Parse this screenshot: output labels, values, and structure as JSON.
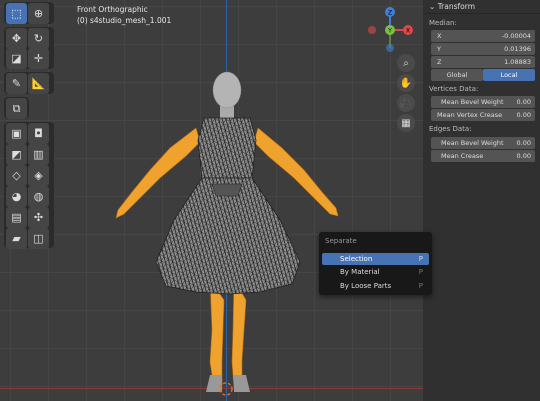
{
  "viewport": {
    "view_name": "Front Orthographic",
    "object_name": "(0) s4studio_mesh_1.001"
  },
  "toolbar": {
    "tools": [
      {
        "icon": "select-box-icon",
        "glyph": "⬚",
        "active": true
      },
      {
        "icon": "cursor-icon",
        "glyph": "⊕",
        "active": false
      },
      {
        "icon": "move-icon",
        "glyph": "✥",
        "active": false
      },
      {
        "icon": "rotate-icon",
        "glyph": "↻",
        "active": false
      },
      {
        "icon": "scale-icon",
        "glyph": "◪",
        "active": false
      },
      {
        "icon": "transform-icon",
        "glyph": "✛",
        "active": false
      },
      {
        "icon": "annotate-icon",
        "glyph": "✎",
        "active": false
      },
      {
        "icon": "measure-icon",
        "glyph": "📐",
        "active": false
      },
      {
        "icon": "add-cube-icon",
        "glyph": "⧉",
        "active": false
      },
      {
        "icon": "extrude-icon",
        "glyph": "▣",
        "active": false
      },
      {
        "icon": "inset-icon",
        "glyph": "◘",
        "active": false
      },
      {
        "icon": "bevel-icon",
        "glyph": "◩",
        "active": false
      },
      {
        "icon": "loop-cut-icon",
        "glyph": "▥",
        "active": false
      },
      {
        "icon": "knife-icon",
        "glyph": "◇",
        "active": false
      },
      {
        "icon": "poly-build-icon",
        "glyph": "◈",
        "active": false
      },
      {
        "icon": "spin-icon",
        "glyph": "◕",
        "active": false
      },
      {
        "icon": "smooth-icon",
        "glyph": "◍",
        "active": false
      },
      {
        "icon": "edge-slide-icon",
        "glyph": "▤",
        "active": false
      },
      {
        "icon": "shrink-fatten-icon",
        "glyph": "✣",
        "active": false
      },
      {
        "icon": "shear-icon",
        "glyph": "▰",
        "active": false
      },
      {
        "icon": "rip-region-icon",
        "glyph": "◫",
        "active": false
      }
    ]
  },
  "gizmo": {
    "x_label": "X",
    "y_label": "Y",
    "z_label": "Z",
    "x_color": "#e0474b",
    "y_color": "#7bc043",
    "z_color": "#3f7fd6"
  },
  "nav_buttons": [
    {
      "icon": "zoom-icon",
      "glyph": "⌕"
    },
    {
      "icon": "pan-hand-icon",
      "glyph": "✋"
    },
    {
      "icon": "camera-icon",
      "glyph": "🎥"
    },
    {
      "icon": "ortho-grid-icon",
      "glyph": "▦"
    }
  ],
  "transform_panel": {
    "header": "Transform",
    "median_label": "Median:",
    "x_label": "X",
    "x_value": "-0.00004",
    "y_label": "Y",
    "y_value": "0.01396",
    "z_label": "Z",
    "z_value": "1.08883",
    "space_options": [
      "Global",
      "Local"
    ],
    "active_space": "Local",
    "vertices_label": "Vertices Data:",
    "v_bevel_label": "Mean Bevel Weight",
    "v_bevel_value": "0.00",
    "v_crease_label": "Mean Vertex Crease",
    "v_crease_value": "0.00",
    "edges_label": "Edges Data:",
    "e_bevel_label": "Mean Bevel Weight",
    "e_bevel_value": "0.00",
    "e_crease_label": "Mean Crease",
    "e_crease_value": "0.00"
  },
  "separate_menu": {
    "title": "Separate",
    "items": [
      {
        "label": "Selection",
        "key": "P",
        "selected": true
      },
      {
        "label": "By Material",
        "key": "P",
        "selected": false
      },
      {
        "label": "By Loose Parts",
        "key": "P",
        "selected": false
      }
    ]
  },
  "colors": {
    "accent": "#4772b3",
    "selection_orange": "#f0a22e",
    "mesh_wire": "#1c1c1c"
  }
}
